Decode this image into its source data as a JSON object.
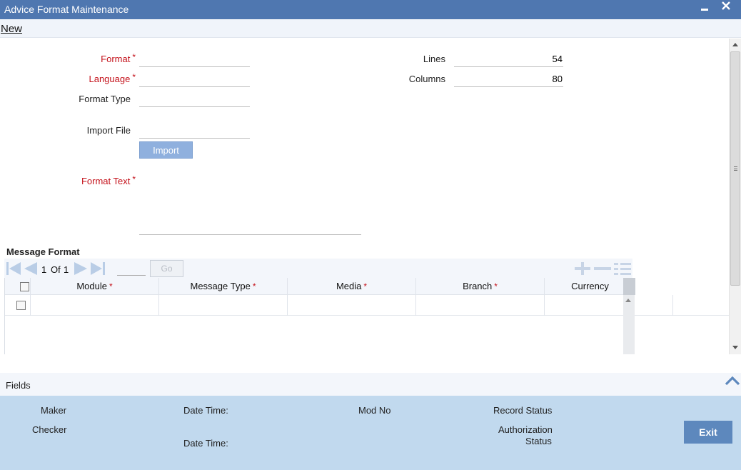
{
  "window": {
    "title": "Advice Format Maintenance",
    "minimize_glyph": "▬",
    "close_glyph": "✕"
  },
  "menu": {
    "new_label": "New"
  },
  "form": {
    "format_label": "Format",
    "format_value": "",
    "language_label": "Language",
    "language_value": "",
    "format_type_label": "Format Type",
    "format_type_value": "",
    "import_file_label": "Import File",
    "import_file_value": "",
    "import_button": "Import",
    "format_text_label": "Format Text",
    "format_text_value": "",
    "lines_label": "Lines",
    "lines_value": "54",
    "columns_label": "Columns",
    "columns_value": "80",
    "required_mark": "*"
  },
  "message_format": {
    "title": "Message Format",
    "page_current": "1",
    "page_of": "Of",
    "page_total": "1",
    "page_input": "",
    "go_label": "Go",
    "columns": [
      "Module",
      "Message Type",
      "Media",
      "Branch",
      "Currency"
    ],
    "required_columns": [
      true,
      true,
      true,
      true,
      false
    ],
    "rows": [
      {
        "Module": "",
        "Message Type": "",
        "Media": "",
        "Branch": "",
        "Currency": ""
      }
    ]
  },
  "fields_bar": {
    "label": "Fields"
  },
  "footer": {
    "maker_label": "Maker",
    "checker_label": "Checker",
    "date_time_label_1": "Date Time:",
    "date_time_label_2": "Date Time:",
    "mod_no_label": "Mod No",
    "record_status_label": "Record Status",
    "authorization_label": "Authorization",
    "status_label": "Status",
    "exit_button": "Exit"
  },
  "colors": {
    "title_bar": "#4f77b0",
    "required": "#c4121b",
    "footer": "#c1d9ee",
    "exit_button": "#5d88bd",
    "import_button": "#8fb0de"
  },
  "icons": {
    "first_page": "first-page-icon",
    "prev_page": "previous-page-icon",
    "next_page": "next-page-icon",
    "last_page": "last-page-icon",
    "add_row": "add-row-icon",
    "delete_row": "delete-row-icon",
    "single_view": "single-view-icon",
    "collapse": "chevron-up-icon"
  }
}
